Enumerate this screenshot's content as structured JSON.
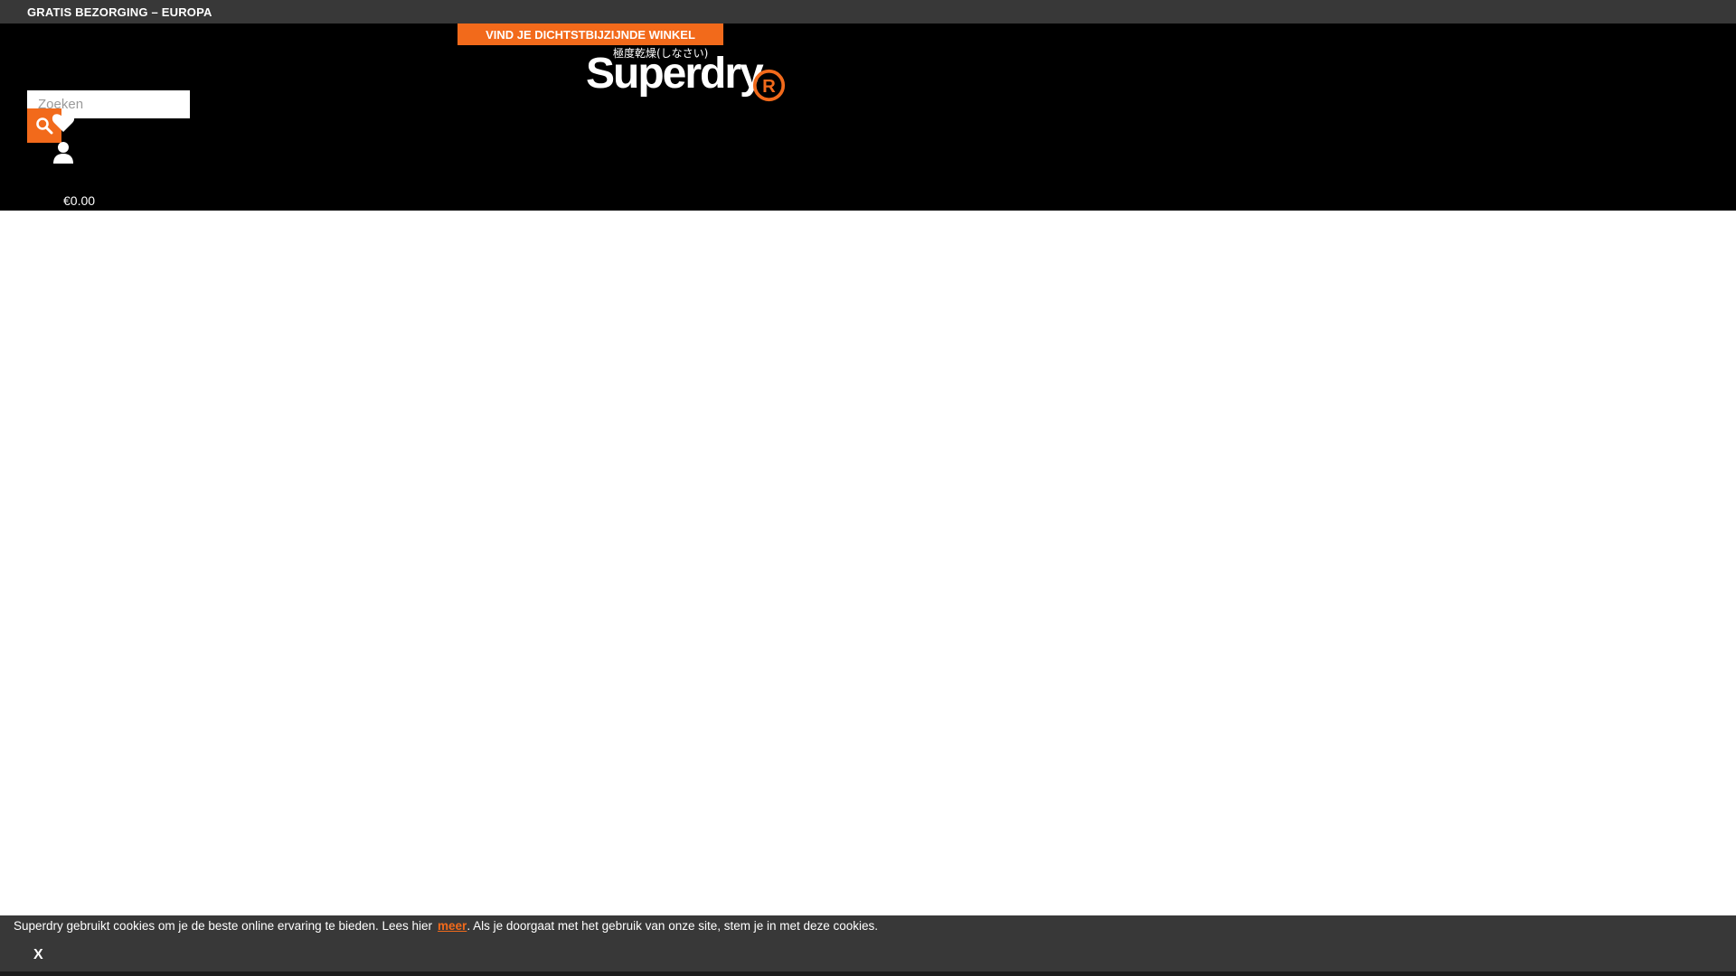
{
  "promo_bar": {
    "text": "GRATIS BEZORGING – EUROPA"
  },
  "header": {
    "store_finder_label": "VIND JE DICHTSTBIJZIJNDE WINKEL",
    "logo": {
      "wordmark": "Superdry",
      "japanese": "極度乾燥(しなさい)",
      "registered_mark": "R"
    },
    "search": {
      "placeholder": "Zoeken",
      "value": ""
    },
    "icons": {
      "search": "search-icon",
      "wishlist": "heart-icon",
      "account": "user-icon"
    },
    "cart_total": "€0.00"
  },
  "cookie_bar": {
    "text_before": "Superdry gebruikt cookies om je de beste online ervaring te bieden. Lees hier",
    "link_label": "meer",
    "text_after": ". Als je doorgaat met het gebruik van onze site, stem je in met deze cookies.",
    "close_label": "X"
  },
  "colors": {
    "accent": "#f26a1b",
    "header_bg": "#000000",
    "bar_bg": "#383838",
    "page_bg": "#ffffff"
  }
}
